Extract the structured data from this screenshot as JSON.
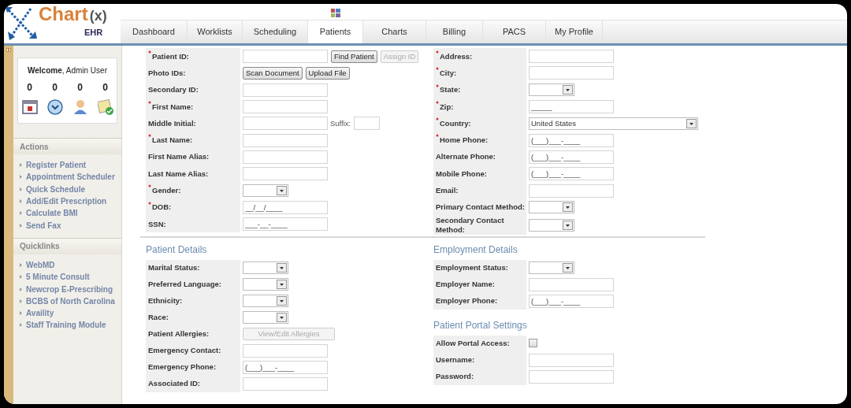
{
  "logo": {
    "name": "Chart",
    "suffix": "(x)",
    "sub": "EHR"
  },
  "tabs": [
    {
      "label": "Dashboard",
      "selected": false
    },
    {
      "label": "Worklists",
      "selected": false
    },
    {
      "label": "Scheduling",
      "selected": false
    },
    {
      "label": "Patients",
      "selected": true
    },
    {
      "label": "Charts",
      "selected": false
    },
    {
      "label": "Billing",
      "selected": false
    },
    {
      "label": "PACS",
      "selected": false
    },
    {
      "label": "My Profile",
      "selected": false
    }
  ],
  "sidebar": {
    "welcome": "**Welcome**, Admin User",
    "counters": [
      {
        "kind": "calendar",
        "count": "0"
      },
      {
        "kind": "clock",
        "count": "0"
      },
      {
        "kind": "person",
        "count": "0"
      },
      {
        "kind": "note",
        "count": "0"
      }
    ],
    "actions": {
      "title": "Actions",
      "items": [
        "Register Patient",
        "Appointment Scheduler",
        "Quick Schedule",
        "Add/Edit Prescription",
        "Calculate BMI",
        "Send Fax"
      ]
    },
    "quicklinks": {
      "title": "Quicklinks",
      "items": [
        "WebMD",
        "5 Minute Consult",
        "Newcrop E-Prescribing",
        "BCBS of North Carolina",
        "Availity",
        "Staff Training Module"
      ]
    }
  },
  "demographics": {
    "left": [
      {
        "label": "Patient ID:",
        "required": true,
        "kind": "text",
        "buttons": [
          {
            "label": "Find Patient",
            "disabled": false
          },
          {
            "label": "Assign ID",
            "disabled": true
          }
        ]
      },
      {
        "label": "Photo IDs:",
        "required": false,
        "kind": "buttons",
        "buttons": [
          {
            "label": "Scan Document",
            "disabled": false
          },
          {
            "label": "Upload File",
            "disabled": false
          }
        ]
      },
      {
        "label": "Secondary ID:",
        "required": false,
        "kind": "text"
      },
      {
        "label": "First Name:",
        "required": true,
        "kind": "text"
      },
      {
        "label": "Middle Initial:",
        "required": false,
        "kind": "text",
        "suffix": "Suffix:"
      },
      {
        "label": "Last Name:",
        "required": true,
        "kind": "text"
      },
      {
        "label": "First Name Alias:",
        "required": false,
        "kind": "text"
      },
      {
        "label": "Last Name Alias:",
        "required": false,
        "kind": "text"
      },
      {
        "label": "Gender:",
        "required": true,
        "kind": "select"
      },
      {
        "label": "DOB:",
        "required": true,
        "kind": "text",
        "value": "__/__/____"
      },
      {
        "label": "SSN:",
        "required": false,
        "kind": "text",
        "value": "___-__-____"
      }
    ],
    "right": [
      {
        "label": "Address:",
        "required": true,
        "kind": "text"
      },
      {
        "label": "City:",
        "required": true,
        "kind": "text"
      },
      {
        "label": "State:",
        "required": true,
        "kind": "select"
      },
      {
        "label": "Zip:",
        "required": true,
        "kind": "text",
        "value": "_____"
      },
      {
        "label": "Country:",
        "required": true,
        "kind": "select",
        "value": "United States"
      },
      {
        "label": "Home Phone:",
        "required": true,
        "kind": "text",
        "value": "(___)___-____"
      },
      {
        "label": "Alternate Phone:",
        "required": false,
        "kind": "text",
        "value": "(___)___-____"
      },
      {
        "label": "Mobile Phone:",
        "required": false,
        "kind": "text",
        "value": "(___)___-____"
      },
      {
        "label": "Email:",
        "required": false,
        "kind": "text"
      },
      {
        "label": "Primary Contact Method:",
        "required": false,
        "kind": "select"
      },
      {
        "label": "Secondary Contact Method:",
        "required": false,
        "kind": "select"
      }
    ]
  },
  "patient_details": {
    "title": "Patient Details",
    "fields": [
      {
        "label": "Marital Status:",
        "required": false,
        "kind": "select"
      },
      {
        "label": "Preferred Language:",
        "required": false,
        "kind": "select"
      },
      {
        "label": "Ethnicity:",
        "required": false,
        "kind": "select"
      },
      {
        "label": "Race:",
        "required": false,
        "kind": "select"
      },
      {
        "label": "Patient Allergies:",
        "required": false,
        "kind": "buttons",
        "buttons": [
          {
            "label": "View/Edit Allergies",
            "disabled": true
          }
        ]
      },
      {
        "label": "Emergency Contact:",
        "required": false,
        "kind": "text"
      },
      {
        "label": "Emergency Phone:",
        "required": false,
        "kind": "text",
        "value": "(___)___-____"
      },
      {
        "label": "Associated ID:",
        "required": false,
        "kind": "text"
      }
    ]
  },
  "employment_details": {
    "title": "Employment Details",
    "fields": [
      {
        "label": "Employment Status:",
        "required": false,
        "kind": "select"
      },
      {
        "label": "Employer Name:",
        "required": false,
        "kind": "text"
      },
      {
        "label": "Employer Phone:",
        "required": false,
        "kind": "text",
        "value": "(___)___-____"
      }
    ]
  },
  "portal_settings": {
    "title": "Patient Portal Settings",
    "fields": [
      {
        "label": "Allow Portal Access:",
        "required": false,
        "kind": "checkbox",
        "checked": false
      },
      {
        "label": "Username:",
        "required": false,
        "kind": "text"
      },
      {
        "label": "Password:",
        "required": false,
        "kind": "text"
      }
    ]
  }
}
